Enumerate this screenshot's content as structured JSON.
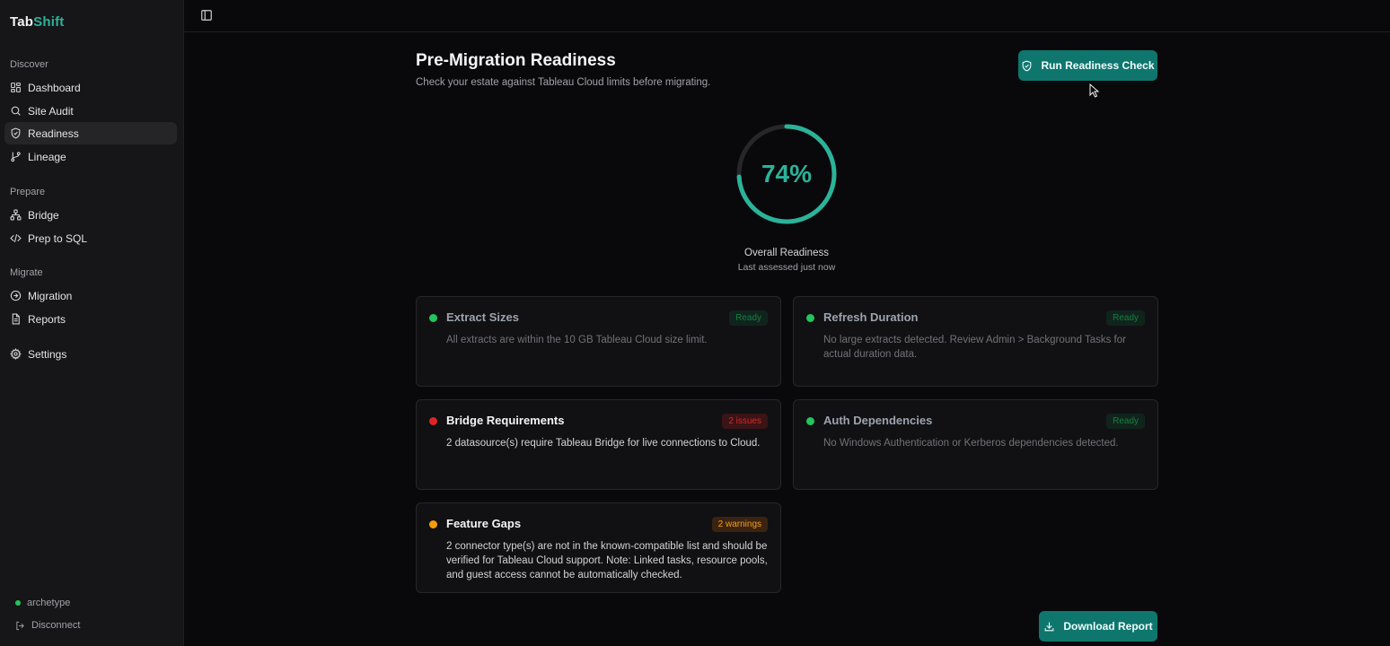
{
  "app": {
    "logo_part1": "Tab",
    "logo_part2": "Shift"
  },
  "sidebar": {
    "sections": [
      {
        "label": "Discover"
      },
      {
        "label": "Prepare"
      },
      {
        "label": "Migrate"
      }
    ],
    "items": [
      {
        "label": "Dashboard",
        "icon": "dashboard-icon"
      },
      {
        "label": "Site Audit",
        "icon": "search-icon"
      },
      {
        "label": "Readiness",
        "icon": "shield-check-icon",
        "active": true
      },
      {
        "label": "Lineage",
        "icon": "git-branch-icon"
      },
      {
        "label": "Bridge",
        "icon": "network-icon"
      },
      {
        "label": "Prep to SQL",
        "icon": "code-icon"
      },
      {
        "label": "Migration",
        "icon": "arrow-circle-icon"
      },
      {
        "label": "Reports",
        "icon": "file-text-icon"
      },
      {
        "label": "Settings",
        "icon": "gear-icon"
      }
    ],
    "footer": {
      "user": "archetype",
      "disconnect": "Disconnect"
    }
  },
  "page": {
    "title": "Pre-Migration Readiness",
    "subtitle": "Check your estate against Tableau Cloud limits before migrating.",
    "run_button": "Run Readiness Check",
    "download_button": "Download Report"
  },
  "readiness": {
    "percent_text": "74%",
    "value": 0.74,
    "label": "Overall Readiness",
    "assessed": "Last assessed just now",
    "ring_color": "#2bb39a",
    "track_color": "#27272a"
  },
  "cards": [
    {
      "title": "Extract Sizes",
      "badge": "Ready",
      "status": "ready",
      "dot_color": "#22c55e",
      "desc": "All extracts are within the 10 GB Tableau Cloud size limit."
    },
    {
      "title": "Refresh Duration",
      "badge": "Ready",
      "status": "ready",
      "dot_color": "#22c55e",
      "desc": "No large extracts detected. Review Admin > Background Tasks for actual duration data."
    },
    {
      "title": "Bridge Requirements",
      "badge": "2 issues",
      "status": "issue",
      "dot_color": "#dc2626",
      "desc": "2 datasource(s) require Tableau Bridge for live connections to Cloud."
    },
    {
      "title": "Auth Dependencies",
      "badge": "Ready",
      "status": "ready",
      "dot_color": "#22c55e",
      "desc": "No Windows Authentication or Kerberos dependencies detected."
    },
    {
      "title": "Feature Gaps",
      "badge": "2 warnings",
      "status": "warn",
      "dot_color": "#f59e0b",
      "desc": "2 connector type(s) are not in the known-compatible list and should be verified for Tableau Cloud support. Note: Linked tasks, resource pools, and guest access cannot be automatically checked."
    }
  ]
}
